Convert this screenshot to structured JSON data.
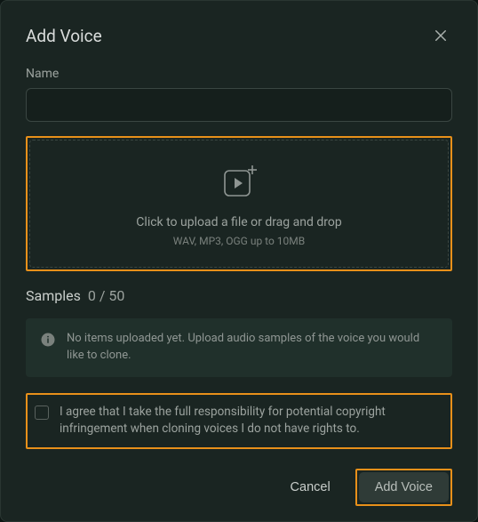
{
  "header": {
    "title": "Add Voice"
  },
  "nameField": {
    "label": "Name",
    "value": ""
  },
  "upload": {
    "mainText": "Click to upload a file or drag and drop",
    "subText": "WAV, MP3, OGG up to 10MB"
  },
  "samples": {
    "label": "Samples",
    "count": "0 / 50"
  },
  "infoBox": {
    "text": "No items uploaded yet. Upload audio samples of the voice you would like to clone."
  },
  "agreement": {
    "text": "I agree that I take the full responsibility for potential copyright infringement when cloning voices I do not have rights to."
  },
  "footer": {
    "cancel": "Cancel",
    "addVoice": "Add Voice"
  }
}
